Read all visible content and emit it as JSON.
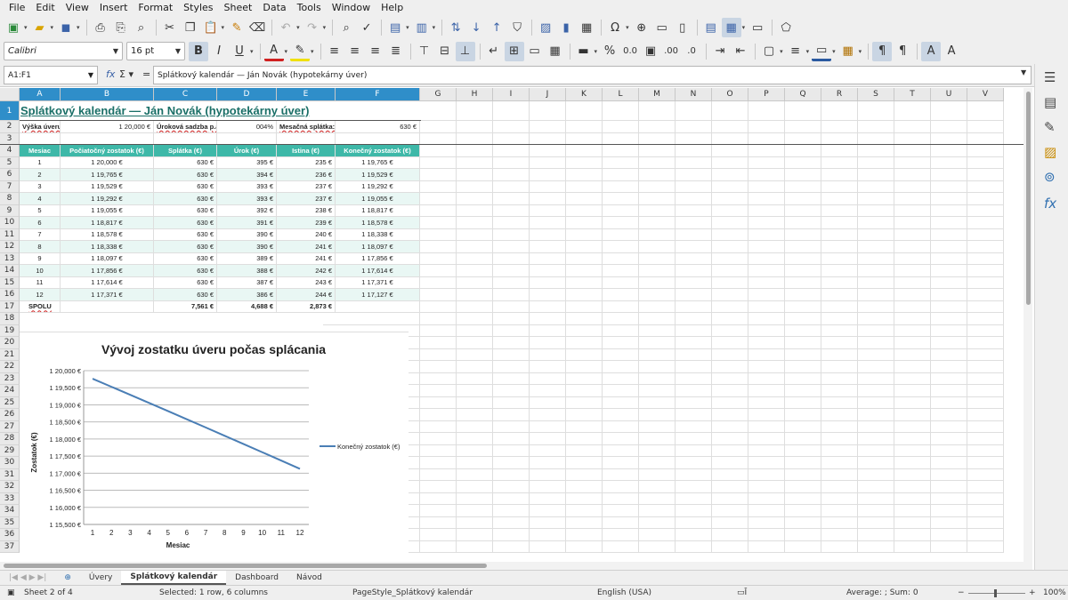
{
  "menu": [
    "File",
    "Edit",
    "View",
    "Insert",
    "Format",
    "Styles",
    "Sheet",
    "Data",
    "Tools",
    "Window",
    "Help"
  ],
  "font": {
    "name": "Calibri",
    "size": "16 pt"
  },
  "formula_bar": {
    "cell_ref": "A1:F1",
    "content": "Splátkový kalendár — Ján Novák (hypotekárny úver)"
  },
  "columns": [
    "A",
    "B",
    "C",
    "D",
    "E",
    "F",
    "G",
    "H",
    "I",
    "J",
    "K",
    "L",
    "M",
    "N",
    "O",
    "P",
    "Q",
    "R",
    "S",
    "T",
    "U",
    "V"
  ],
  "rows": [
    "1",
    "2",
    "3",
    "4",
    "5",
    "6",
    "7",
    "8",
    "9",
    "10",
    "11",
    "12",
    "13",
    "14",
    "15",
    "16",
    "17",
    "18",
    "19",
    "20",
    "21",
    "22",
    "23",
    "24",
    "25",
    "26",
    "27",
    "28",
    "29",
    "30",
    "31",
    "32",
    "33",
    "34",
    "35",
    "36",
    "37"
  ],
  "sheet": {
    "title": "Splátkový kalendár — Ján Novák (hypotekárny úver)",
    "row2": {
      "a": "Výška úveru:",
      "b": "1 20,000 €",
      "c": "Úroková sadzba p.a.:",
      "d": "004%",
      "e": "Mesačná splátka:",
      "f": "630 €"
    },
    "headers": [
      "Mesiac",
      "Počiatočný zostatok (€)",
      "Splátka (€)",
      "Úrok (€)",
      "Istina (€)",
      "Konečný zostatok (€)"
    ],
    "data": [
      [
        "1",
        "1 20,000 €",
        "630 €",
        "395 €",
        "235 €",
        "1 19,765 €"
      ],
      [
        "2",
        "1 19,765 €",
        "630 €",
        "394 €",
        "236 €",
        "1 19,529 €"
      ],
      [
        "3",
        "1 19,529 €",
        "630 €",
        "393 €",
        "237 €",
        "1 19,292 €"
      ],
      [
        "4",
        "1 19,292 €",
        "630 €",
        "393 €",
        "237 €",
        "1 19,055 €"
      ],
      [
        "5",
        "1 19,055 €",
        "630 €",
        "392 €",
        "238 €",
        "1 18,817 €"
      ],
      [
        "6",
        "1 18,817 €",
        "630 €",
        "391 €",
        "239 €",
        "1 18,578 €"
      ],
      [
        "7",
        "1 18,578 €",
        "630 €",
        "390 €",
        "240 €",
        "1 18,338 €"
      ],
      [
        "8",
        "1 18,338 €",
        "630 €",
        "390 €",
        "241 €",
        "1 18,097 €"
      ],
      [
        "9",
        "1 18,097 €",
        "630 €",
        "389 €",
        "241 €",
        "1 17,856 €"
      ],
      [
        "10",
        "1 17,856 €",
        "630 €",
        "388 €",
        "242 €",
        "1 17,614 €"
      ],
      [
        "11",
        "1 17,614 €",
        "630 €",
        "387 €",
        "243 €",
        "1 17,371 €"
      ],
      [
        "12",
        "1 17,371 €",
        "630 €",
        "386 €",
        "244 €",
        "1 17,127 €"
      ]
    ],
    "totals": {
      "label": "SPOLU",
      "c": "7,561 €",
      "d": "4,688 €",
      "e": "2,873 €"
    }
  },
  "chart_data": {
    "type": "line",
    "title": "Vývoj zostatku úveru počas splácania",
    "xlabel": "Mesiac",
    "ylabel": "Zostatok (€)",
    "x": [
      1,
      2,
      3,
      4,
      5,
      6,
      7,
      8,
      9,
      10,
      11,
      12
    ],
    "y_ticks": [
      "1 15,500 €",
      "1 16,000 €",
      "1 16,500 €",
      "1 17,000 €",
      "1 17,500 €",
      "1 18,000 €",
      "1 18,500 €",
      "1 19,000 €",
      "1 19,500 €",
      "1 20,000 €"
    ],
    "ylim": [
      115500,
      120000
    ],
    "series": [
      {
        "name": "Konečný zostatok (€)",
        "values": [
          119765,
          119529,
          119292,
          119055,
          118817,
          118578,
          118338,
          118097,
          117856,
          117614,
          117371,
          117127
        ],
        "color": "#4a7eb5"
      }
    ],
    "legend": "right"
  },
  "tabs": [
    "Úvery",
    "Splátkový kalendár",
    "Dashboard",
    "Návod"
  ],
  "active_tab": 1,
  "status": {
    "sheet": "Sheet 2 of 4",
    "selection": "Selected: 1 row, 6 columns",
    "pagestyle": "PageStyle_Splátkový kalendár",
    "lang": "English (USA)",
    "sum": "Average: ; Sum: 0",
    "zoom": "100%"
  }
}
